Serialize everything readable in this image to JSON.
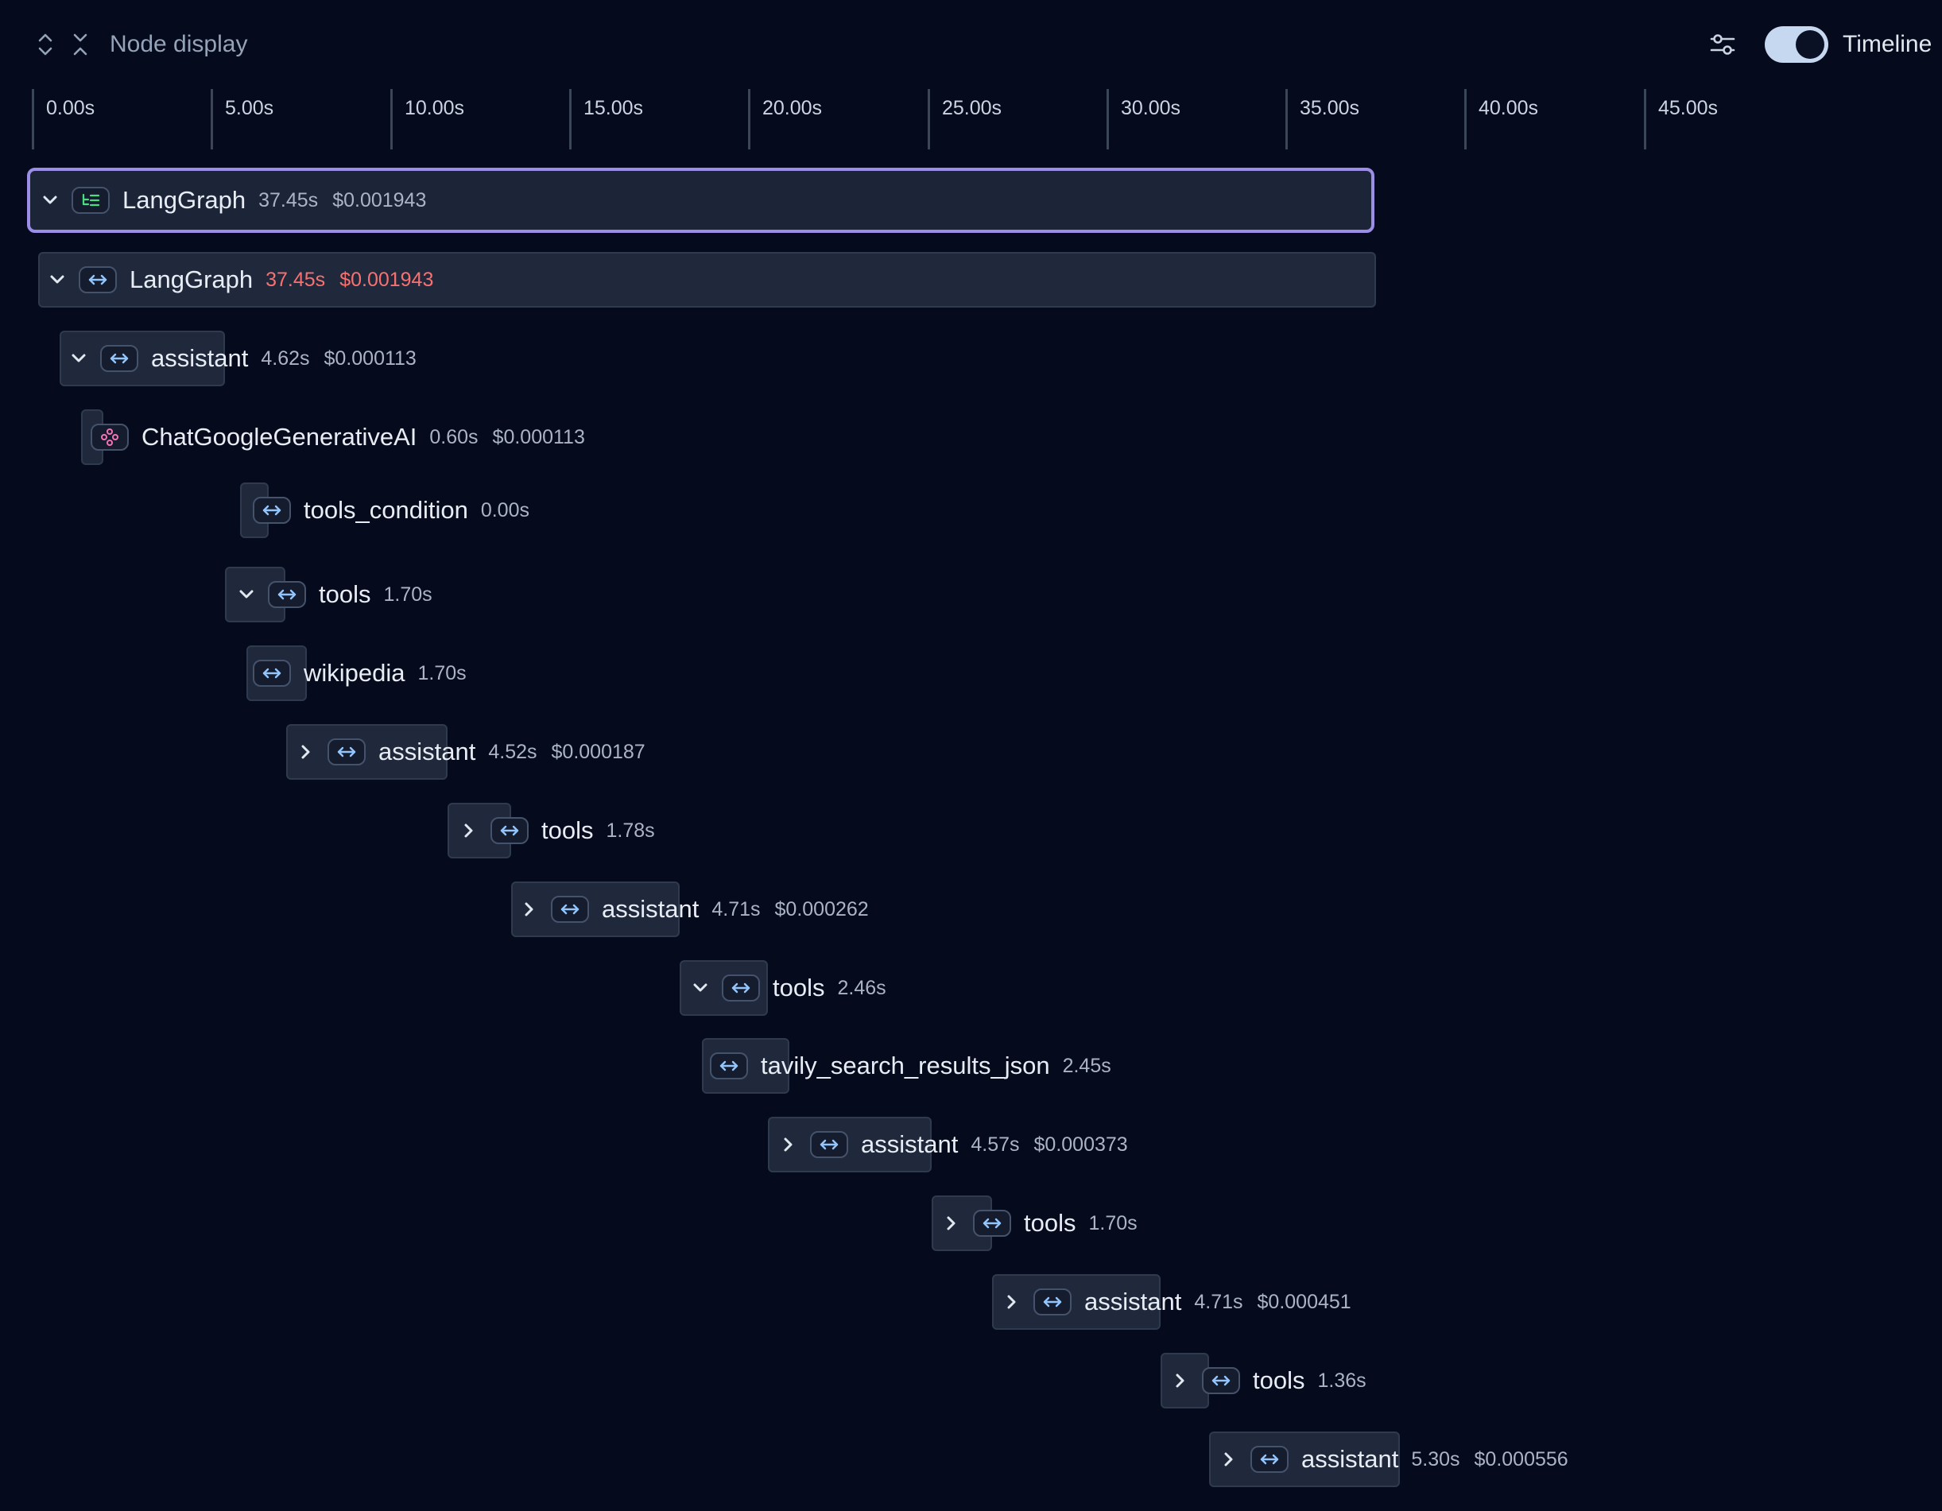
{
  "toolbar": {
    "expand_icon": "expand-vertical-icon",
    "collapse_icon": "collapse-vertical-icon",
    "node_display_label": "Node display",
    "filter_icon": "sliders-icon",
    "timeline_toggle_on": true,
    "timeline_label": "Timeline"
  },
  "ruler": {
    "ticks": [
      "0.00s",
      "5.00s",
      "10.00s",
      "15.00s",
      "20.00s",
      "25.00s",
      "30.00s",
      "35.00s",
      "40.00s",
      "45.00s"
    ]
  },
  "colors": {
    "background": "#050a1c",
    "bar": "#1f293b",
    "selected_border": "#9c8ee6",
    "error_text": "#f87171",
    "icon_accent": "#93c5fd",
    "llm_icon": "#f472b6",
    "graph_icon": "#4ade80"
  },
  "rows": [
    {
      "name": "LangGraph",
      "duration": "37.45s",
      "cost": "$0.001943",
      "chevron": "down",
      "icon": "graph-icon",
      "selected": true,
      "error": false
    },
    {
      "name": "LangGraph",
      "duration": "37.45s",
      "cost": "$0.001943",
      "chevron": "down",
      "icon": "chain-icon",
      "selected": false,
      "error": true
    },
    {
      "name": "assistant",
      "duration": "4.62s",
      "cost": "$0.000113",
      "chevron": "down",
      "icon": "chain-icon",
      "selected": false,
      "error": false
    },
    {
      "name": "ChatGoogleGenerativeAI",
      "duration": "0.60s",
      "cost": "$0.000113",
      "chevron": "none",
      "icon": "llm-icon",
      "selected": false,
      "error": false
    },
    {
      "name": "tools_condition",
      "duration": "0.00s",
      "cost": "",
      "chevron": "none",
      "icon": "chain-icon",
      "selected": false,
      "error": false
    },
    {
      "name": "tools",
      "duration": "1.70s",
      "cost": "",
      "chevron": "down",
      "icon": "chain-icon",
      "selected": false,
      "error": false
    },
    {
      "name": "wikipedia",
      "duration": "1.70s",
      "cost": "",
      "chevron": "none",
      "icon": "chain-icon",
      "selected": false,
      "error": false
    },
    {
      "name": "assistant",
      "duration": "4.52s",
      "cost": "$0.000187",
      "chevron": "right",
      "icon": "chain-icon",
      "selected": false,
      "error": false
    },
    {
      "name": "tools",
      "duration": "1.78s",
      "cost": "",
      "chevron": "right",
      "icon": "chain-icon",
      "selected": false,
      "error": false
    },
    {
      "name": "assistant",
      "duration": "4.71s",
      "cost": "$0.000262",
      "chevron": "right",
      "icon": "chain-icon",
      "selected": false,
      "error": false
    },
    {
      "name": "tools",
      "duration": "2.46s",
      "cost": "",
      "chevron": "down",
      "icon": "chain-icon",
      "selected": false,
      "error": false
    },
    {
      "name": "tavily_search_results_json",
      "duration": "2.45s",
      "cost": "",
      "chevron": "none",
      "icon": "chain-icon",
      "selected": false,
      "error": false
    },
    {
      "name": "assistant",
      "duration": "4.57s",
      "cost": "$0.000373",
      "chevron": "right",
      "icon": "chain-icon",
      "selected": false,
      "error": false
    },
    {
      "name": "tools",
      "duration": "1.70s",
      "cost": "",
      "chevron": "right",
      "icon": "chain-icon",
      "selected": false,
      "error": false
    },
    {
      "name": "assistant",
      "duration": "4.71s",
      "cost": "$0.000451",
      "chevron": "right",
      "icon": "chain-icon",
      "selected": false,
      "error": false
    },
    {
      "name": "tools",
      "duration": "1.36s",
      "cost": "",
      "chevron": "right",
      "icon": "chain-icon",
      "selected": false,
      "error": false
    },
    {
      "name": "assistant",
      "duration": "5.30s",
      "cost": "$0.000556",
      "chevron": "right",
      "icon": "chain-icon",
      "selected": false,
      "error": false
    }
  ]
}
